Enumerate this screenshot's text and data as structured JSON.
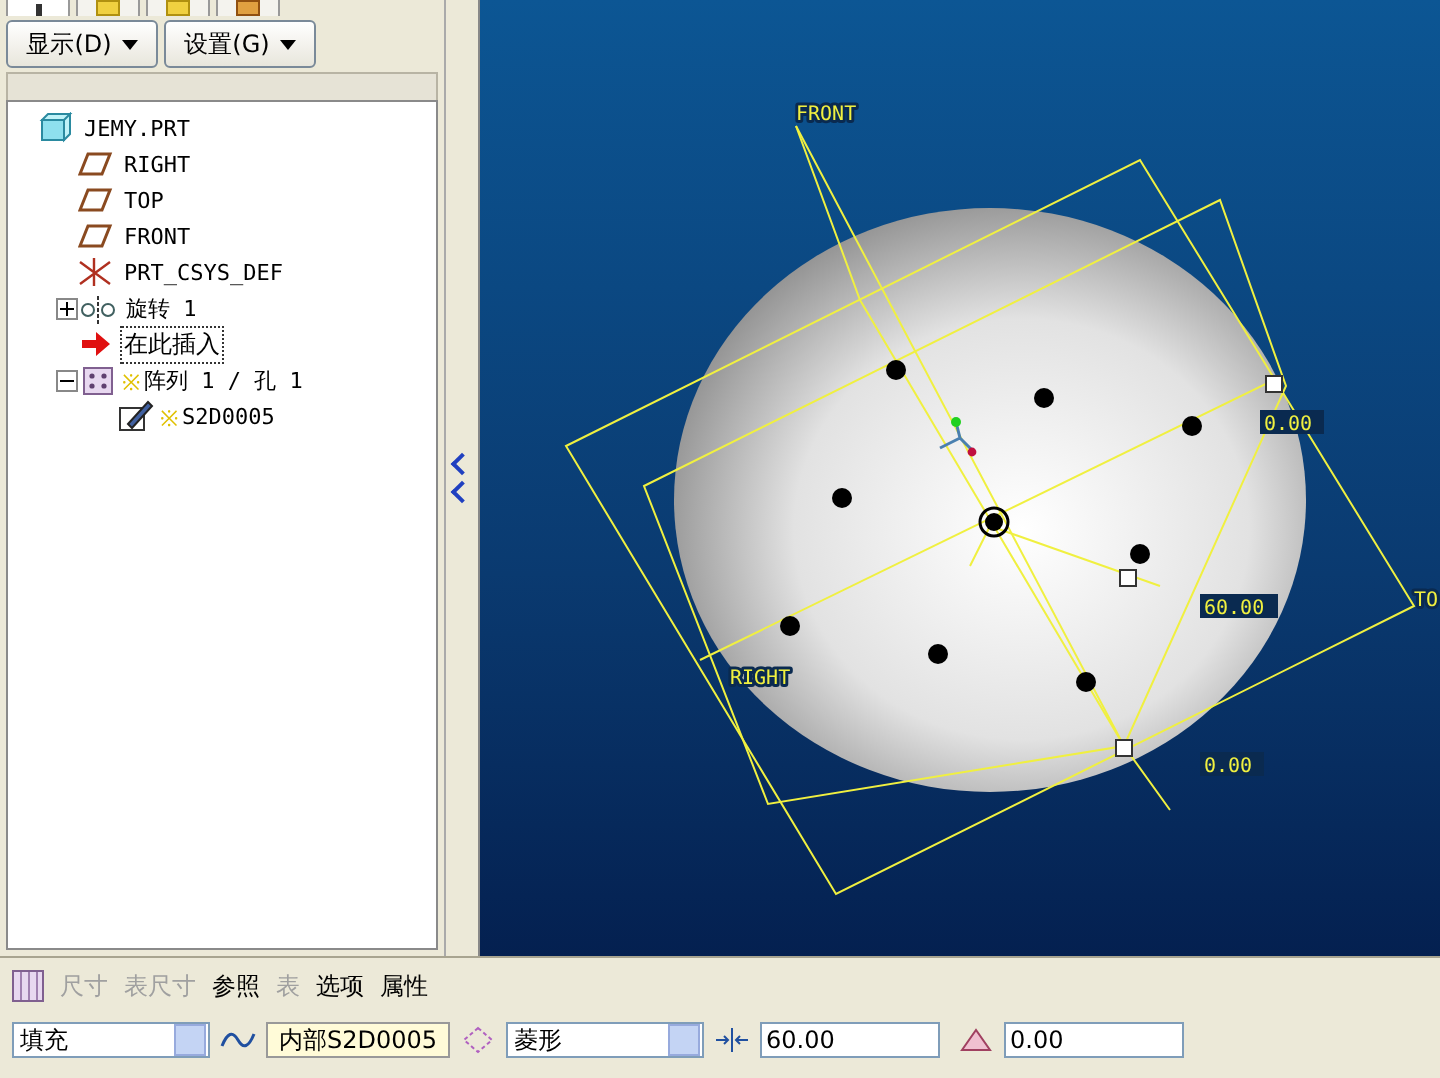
{
  "panel_tabs": [
    {
      "selected": true
    },
    {
      "selected": false
    },
    {
      "selected": false
    },
    {
      "selected": false
    }
  ],
  "panel_buttons": [
    {
      "label": "显示(D)"
    },
    {
      "label": "设置(G)"
    }
  ],
  "tree": {
    "label": "JEMY.PRT",
    "kind": "part",
    "selected": false,
    "children": [
      {
        "label": "RIGHT",
        "kind": "plane",
        "selected": false
      },
      {
        "label": "TOP",
        "kind": "plane",
        "selected": false
      },
      {
        "label": "FRONT",
        "kind": "plane",
        "selected": false
      },
      {
        "label": "PRT_CSYS_DEF",
        "kind": "csys",
        "selected": false
      },
      {
        "label": "旋转 1",
        "kind": "revolve",
        "expanded": false,
        "selected": false
      },
      {
        "label": "在此插入",
        "kind": "insert",
        "selected": true
      },
      {
        "label": "阵列 1 / 孔 1",
        "kind": "pattern",
        "expanded": true,
        "mark": "※",
        "selected": false,
        "children": [
          {
            "label": "S2D0005",
            "kind": "sketch",
            "mark": "※",
            "selected": false
          }
        ]
      }
    ]
  },
  "viewport": {
    "labels": [
      {
        "text": "FRONT",
        "kind": "plane"
      },
      {
        "text": "RIGHT",
        "kind": "plane"
      },
      {
        "text": "TO",
        "kind": "plane"
      },
      {
        "text": "0.00",
        "kind": "dim"
      },
      {
        "text": "60.00",
        "kind": "dim"
      },
      {
        "text": "0.00",
        "kind": "dim"
      }
    ]
  },
  "dashboard": {
    "tabs": [
      {
        "label": "尺寸",
        "disabled": true
      },
      {
        "label": "表尺寸",
        "disabled": true
      },
      {
        "label": "参照",
        "disabled": false
      },
      {
        "label": "表",
        "disabled": true
      },
      {
        "label": "选项",
        "disabled": false
      },
      {
        "label": "属性",
        "disabled": false
      }
    ],
    "controls": [
      {
        "kind": "select",
        "value": "填充"
      },
      {
        "kind": "collector",
        "value": "内部S2D0005"
      },
      {
        "kind": "select",
        "value": "菱形"
      },
      {
        "kind": "input",
        "value": "60.00"
      },
      {
        "kind": "input",
        "value": "0.00"
      }
    ]
  }
}
